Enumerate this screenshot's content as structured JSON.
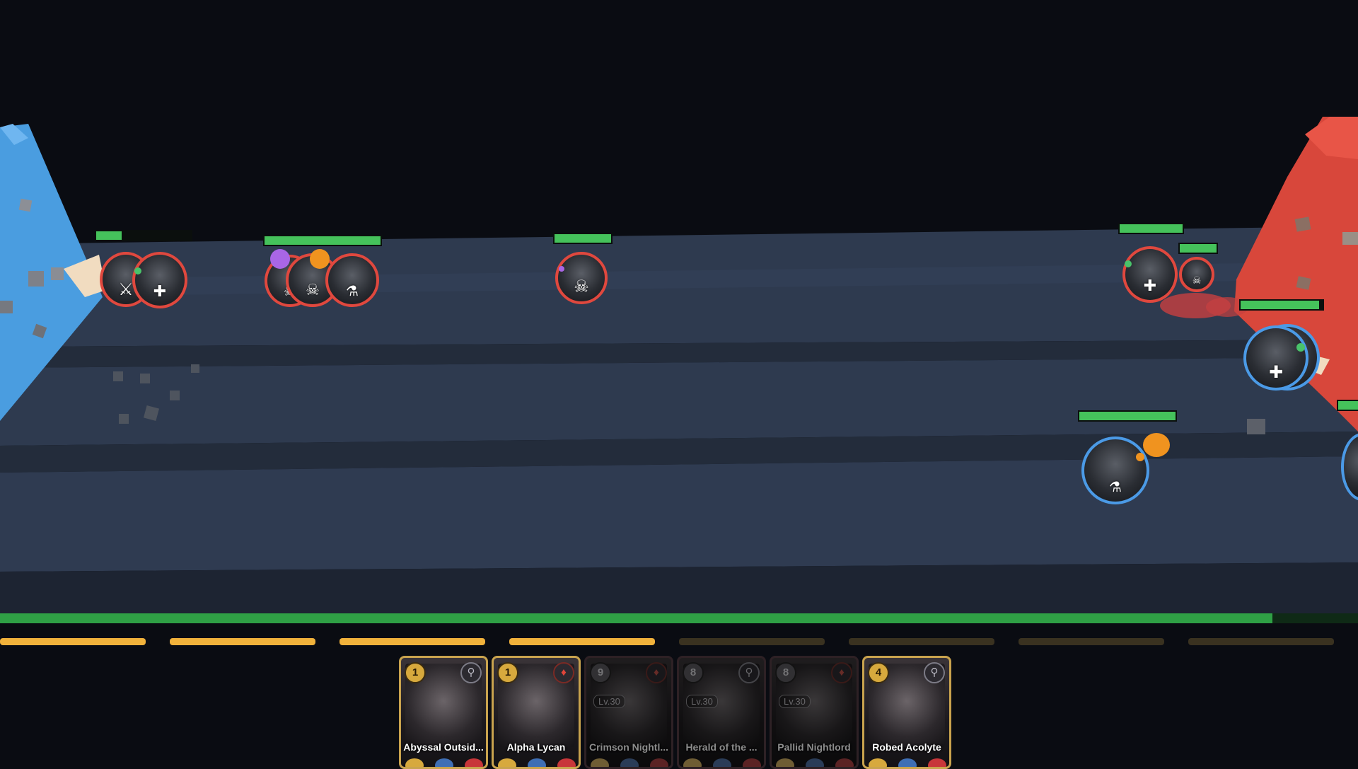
{
  "colors": {
    "enemy_ring": "#e0483e",
    "ally_ring": "#4b9ae6",
    "hp_bar": "#45c25b",
    "mana_bar": "#2fa045",
    "energy_on": "#f1b23b",
    "enemy_base": "#d8473b",
    "ally_base": "#4a9de0"
  },
  "player_mana_fraction": 0.937,
  "energy": {
    "filled": 4,
    "total": 8
  },
  "units": [
    {
      "id": "enemy-1",
      "team": "enemy",
      "icon": "crossed-swords-icon",
      "glyph": "⚔",
      "hp": 1.0
    },
    {
      "id": "enemy-2",
      "team": "enemy",
      "icon": "heal-plus-icon",
      "glyph": "✚",
      "hp": 1.0
    },
    {
      "id": "enemy-3",
      "team": "enemy",
      "icon": "skull-icon",
      "glyph": "☠",
      "hp": 1.0
    },
    {
      "id": "enemy-4",
      "team": "enemy",
      "icon": "skull-icon",
      "glyph": "☠",
      "hp": 1.0
    },
    {
      "id": "enemy-5",
      "team": "enemy",
      "icon": "potion-icon",
      "glyph": "⚗",
      "hp": 1.0
    },
    {
      "id": "enemy-6",
      "team": "enemy",
      "icon": "skull-icon",
      "glyph": "☠",
      "hp": 1.0
    },
    {
      "id": "ally-1",
      "team": "ally",
      "icon": "heal-plus-icon",
      "glyph": "✚",
      "hp": 1.0
    },
    {
      "id": "ally-2",
      "team": "ally",
      "icon": "skull-icon",
      "glyph": "☠",
      "hp": 1.0
    },
    {
      "id": "ally-3",
      "team": "ally",
      "icon": "heal-plus-icon",
      "glyph": "✚",
      "hp": 0.96
    },
    {
      "id": "ally-4",
      "team": "ally",
      "icon": "potion-icon",
      "glyph": "⚗",
      "hp": 1.0
    }
  ],
  "hand": [
    {
      "name": "Abyssal Outsid...",
      "cost": "1",
      "element": "neutral-icon",
      "element_glyph": "⚲",
      "locked": false,
      "level": ""
    },
    {
      "name": "Alpha Lycan",
      "cost": "1",
      "element": "fire-drop-icon",
      "element_glyph": "♦",
      "locked": false,
      "level": ""
    },
    {
      "name": "Crimson Nightl...",
      "cost": "9",
      "element": "fire-drop-icon",
      "element_glyph": "♦",
      "locked": true,
      "level": "Lv.30"
    },
    {
      "name": "Herald of the ...",
      "cost": "8",
      "element": "neutral-icon",
      "element_glyph": "⚲",
      "locked": true,
      "level": "Lv.30"
    },
    {
      "name": "Pallid Nightlord",
      "cost": "8",
      "element": "fire-drop-icon",
      "element_glyph": "♦",
      "locked": true,
      "level": "Lv.30"
    },
    {
      "name": "Robed Acolyte",
      "cost": "4",
      "element": "neutral-icon",
      "element_glyph": "⚲",
      "locked": false,
      "level": ""
    }
  ]
}
